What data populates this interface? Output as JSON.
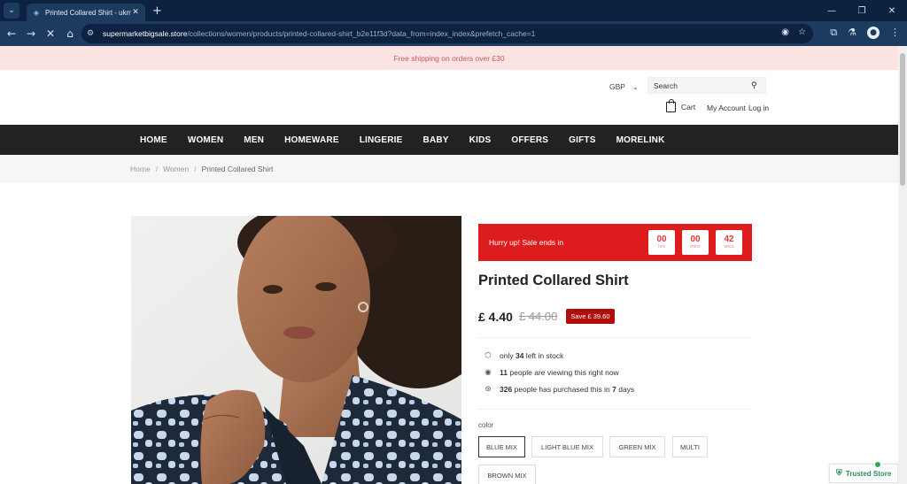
{
  "browser": {
    "tab_switcher_icon": "chevron-down-icon",
    "tab": {
      "title": "Printed Collared Shirt - ukmsh",
      "favicon": "site-icon"
    },
    "new_tab_label": "+",
    "url_host": "supermarketbigsale.store",
    "url_path": "/collections/women/products/printed-collared-shirt_b2e11f3d?data_from=index_index&prefetch_cache=1"
  },
  "announcement": "Free shipping on orders over £30",
  "header": {
    "currency": "GBP",
    "search_placeholder": "Search",
    "cart_label": "Cart",
    "account_label": "My Account",
    "login_label": "Log in"
  },
  "nav": {
    "items": [
      "HOME",
      "WOMEN",
      "MEN",
      "HOMEWARE",
      "LINGERIE",
      "BABY",
      "KIDS",
      "OFFERS",
      "GIFTS",
      "MORELINK"
    ]
  },
  "breadcrumb": {
    "home": "Home",
    "section": "Women",
    "current": "Printed Collared Shirt",
    "separator": "/"
  },
  "countdown": {
    "message": "Hurry up!  Sale ends in",
    "hours": "00",
    "hours_unit": "hrs",
    "mins": "00",
    "mins_unit": "mins",
    "secs": "42",
    "secs_unit": "secs"
  },
  "product": {
    "title": "Printed Collared Shirt",
    "price": "£ 4.40",
    "compare_price": "£ 44.00",
    "save_badge": "Save £ 39.60",
    "stock_pre": "only ",
    "stock_count": "34",
    "stock_post": " left in stock",
    "viewing_count": "11",
    "viewing_text": " people are viewing this right now",
    "purchased_count": "326",
    "purchased_mid": " people has purchased this in ",
    "purchased_days": "7",
    "purchased_post": " days",
    "color_label": "color",
    "colors": [
      "BLUE MIX",
      "LIGHT BLUE MIX",
      "GREEN MIX",
      "MULTI",
      "BROWN MIX"
    ],
    "selected_color": "BLUE MIX"
  },
  "trusted_badge": "Trusted Store",
  "colors": {
    "nav_bg": "#222222",
    "countdown_bg": "#dd1d1d",
    "save_bg": "#b10d0d",
    "announcement_bg": "#fce4e4",
    "trusted": "#2e8b57"
  }
}
